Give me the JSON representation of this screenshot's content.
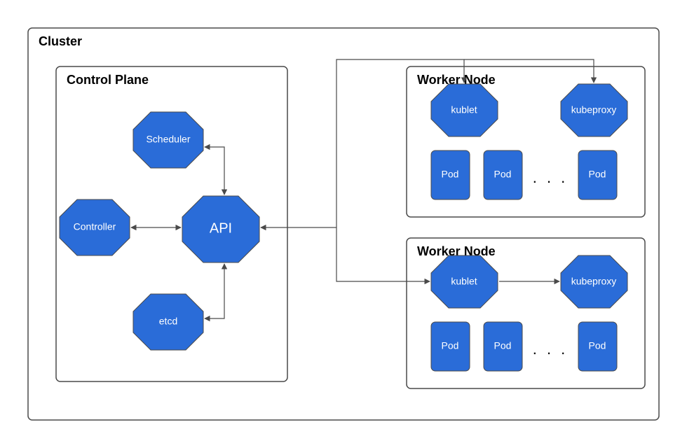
{
  "cluster": {
    "title": "Cluster"
  },
  "control_plane": {
    "title": "Control Plane",
    "components": {
      "scheduler": "Scheduler",
      "controller": "Controller",
      "api": "API",
      "etcd": "etcd"
    }
  },
  "worker_nodes": [
    {
      "title": "Worker Node",
      "kubelet": "kublet",
      "kubeproxy": "kubeproxy",
      "pods": [
        "Pod",
        "Pod",
        "Pod"
      ],
      "ellipsis": ". . ."
    },
    {
      "title": "Worker Node",
      "kubelet": "kublet",
      "kubeproxy": "kubeproxy",
      "pods": [
        "Pod",
        "Pod",
        "Pod"
      ],
      "ellipsis": ". . ."
    }
  ],
  "colors": {
    "node_fill": "#2a6cd8",
    "border": "#4a4a4a"
  }
}
